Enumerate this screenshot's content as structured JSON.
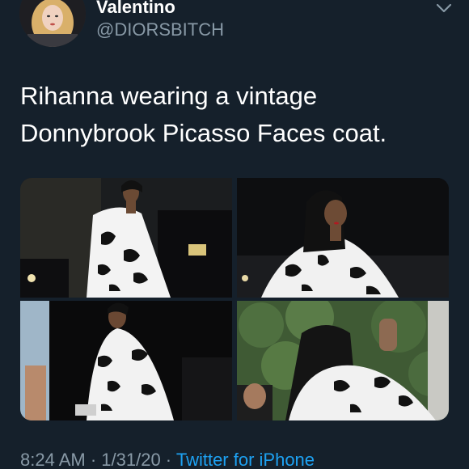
{
  "user": {
    "display_name": "Valentino",
    "handle": "@DIORSBITCH",
    "avatar_icon": "profile-avatar"
  },
  "tweet": {
    "text_line_1": "Rihanna wearing a vintage",
    "text_line_2": "Donnybrook Picasso Faces coat."
  },
  "media": {
    "photos": [
      "photo-1",
      "photo-2",
      "photo-3",
      "photo-4"
    ]
  },
  "meta": {
    "time": "8:24 AM",
    "separator_1": " · ",
    "date": "1/31/20",
    "separator_2": " · ",
    "source": "Twitter for iPhone"
  },
  "colors": {
    "background": "#15202b",
    "secondary_text": "#8899a6",
    "link": "#1da1f2"
  }
}
